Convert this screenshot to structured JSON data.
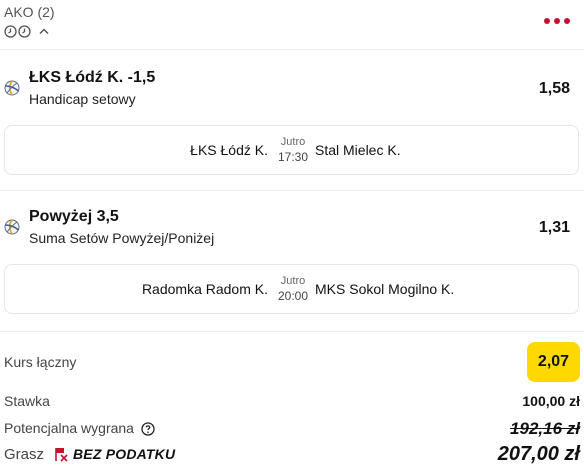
{
  "header": {
    "title": "AKO (2)",
    "more_icon": "more-dots-icon"
  },
  "bets": [
    {
      "pick": "ŁKS Łódź K. -1,5",
      "market": "Handicap setowy",
      "odds": "1,58",
      "match": {
        "home": "ŁKS Łódź K.",
        "day": "Jutro",
        "time": "17:30",
        "away": "Stal Mielec K."
      }
    },
    {
      "pick": "Powyżej 3,5",
      "market": "Suma Setów Powyżej/Poniżej",
      "odds": "1,31",
      "match": {
        "home": "Radomka Radom K.",
        "day": "Jutro",
        "time": "20:00",
        "away": "MKS Sokol Mogilno K."
      }
    }
  ],
  "summary": {
    "total_odds_label": "Kurs łączny",
    "total_odds": "2,07",
    "stake_label": "Stawka",
    "stake": "100,00 zł",
    "potential_win_label": "Potencjalna wygrana",
    "potential_win": "192,16 zł",
    "grasz_label": "Grasz",
    "tax_free_label": "BEZ PODATKU",
    "final_win": "207,00 zł"
  },
  "colors": {
    "accent_red": "#c8102e",
    "odds_badge": "#fdd900"
  }
}
